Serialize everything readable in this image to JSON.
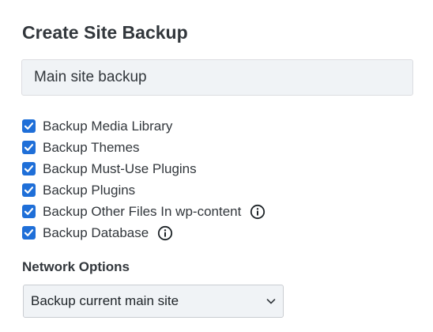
{
  "title": "Create Site Backup",
  "backup_name": {
    "value": "Main site backup",
    "placeholder": ""
  },
  "options": [
    {
      "label": "Backup Media Library",
      "checked": true,
      "info": false
    },
    {
      "label": "Backup Themes",
      "checked": true,
      "info": false
    },
    {
      "label": "Backup Must-Use Plugins",
      "checked": true,
      "info": false
    },
    {
      "label": "Backup Plugins",
      "checked": true,
      "info": false
    },
    {
      "label": "Backup Other Files In wp-content",
      "checked": true,
      "info": true
    },
    {
      "label": "Backup Database",
      "checked": true,
      "info": true
    }
  ],
  "network_options": {
    "heading": "Network Options",
    "selected": "Backup current main site"
  },
  "colors": {
    "checkbox_accent": "#1f6fd8",
    "text": "#32373c",
    "field_background": "#f0f3f6"
  },
  "icons": {
    "checkbox": "checkmark-icon",
    "info": "info-circle-icon",
    "select": "chevron-down-icon"
  }
}
